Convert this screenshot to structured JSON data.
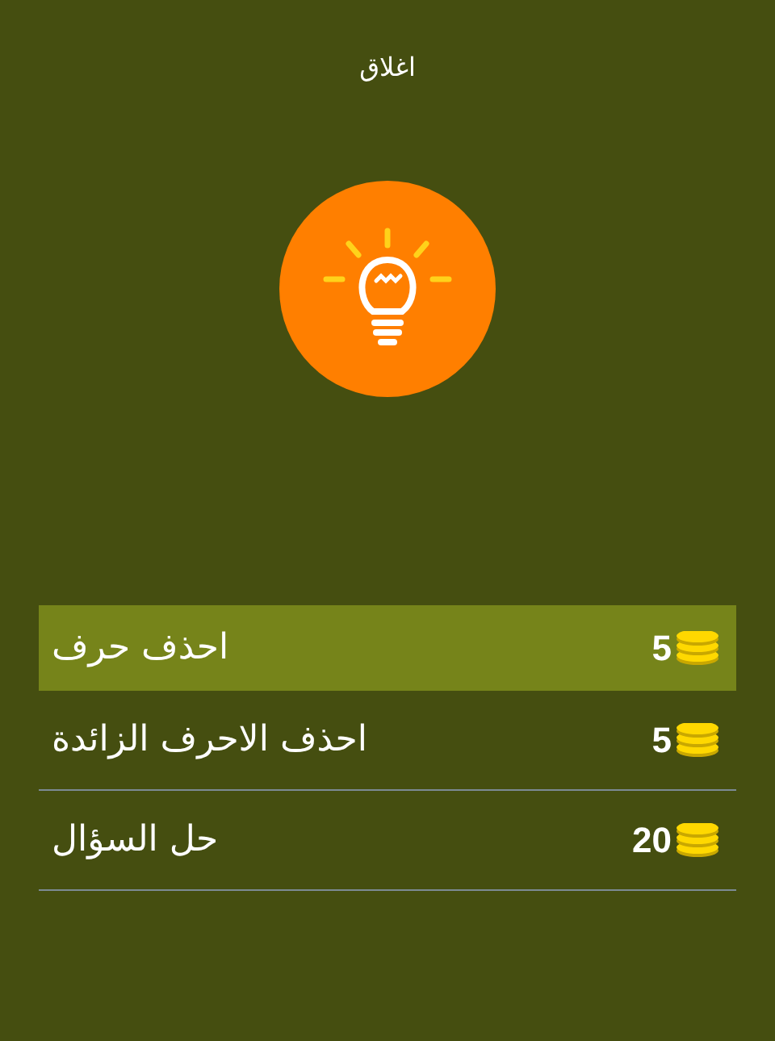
{
  "title": "اغلاق",
  "options": [
    {
      "label": "احذف حرف",
      "cost": "5",
      "selected": true
    },
    {
      "label": "احذف الاحرف الزائدة",
      "cost": "5",
      "selected": false
    },
    {
      "label": "حل السؤال",
      "cost": "20",
      "selected": false
    }
  ]
}
